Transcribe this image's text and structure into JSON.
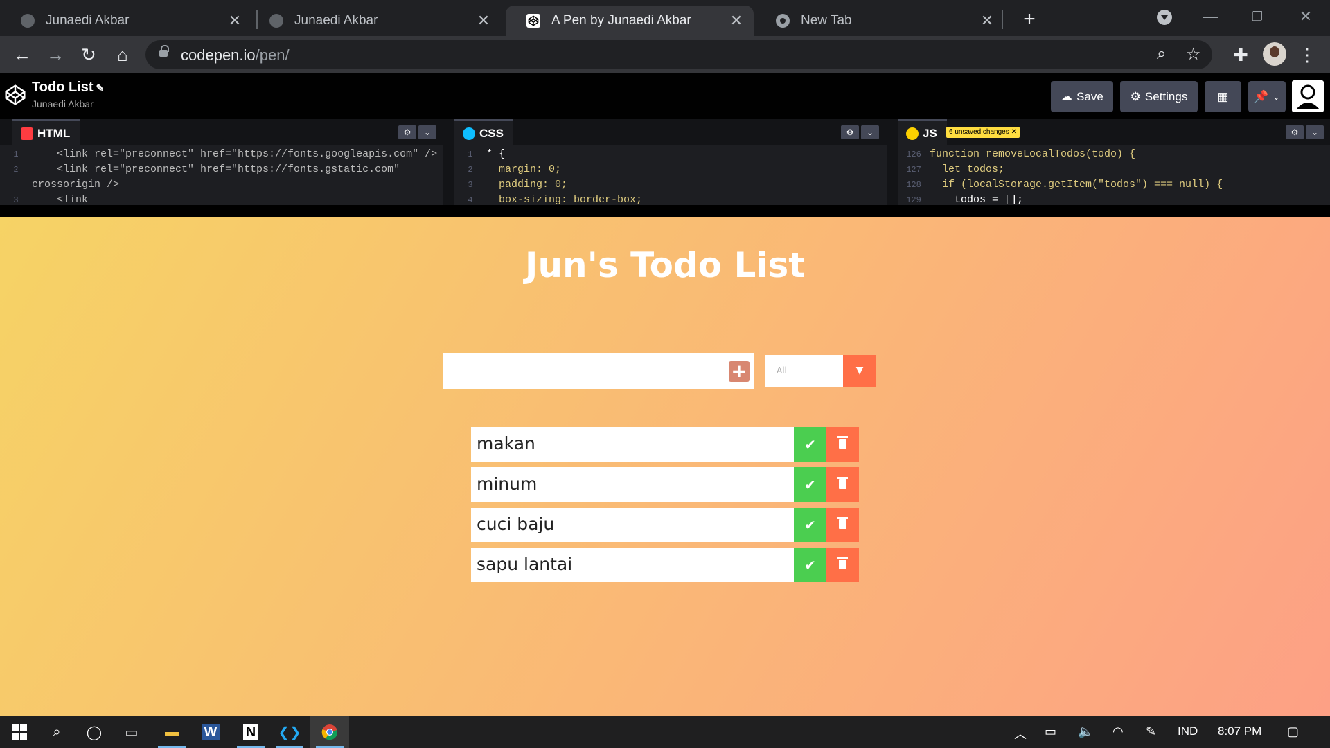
{
  "browser": {
    "tabs": [
      {
        "title": "Junaedi Akbar",
        "active": false
      },
      {
        "title": "Junaedi Akbar",
        "active": false
      },
      {
        "title": "A Pen by Junaedi Akbar",
        "active": true
      },
      {
        "title": "New Tab",
        "active": false
      }
    ],
    "url_host": "codepen.io",
    "url_path": "/pen/"
  },
  "codepen": {
    "pen_title": "Todo List",
    "author": "Junaedi Akbar",
    "save_label": "Save",
    "settings_label": "Settings",
    "editors": {
      "html": {
        "label": "HTML",
        "lines": [
          {
            "n": "1",
            "text": "    <link rel=\"preconnect\" href=\"https://fonts.googleapis.com\" />"
          },
          {
            "n": "2",
            "text": "    <link rel=\"preconnect\" href=\"https://fonts.gstatic.com\""
          },
          {
            "n": "",
            "text": "crossorigin />"
          },
          {
            "n": "3",
            "text": "    <link"
          }
        ]
      },
      "css": {
        "label": "CSS",
        "lines": [
          {
            "n": "1",
            "text": "* {"
          },
          {
            "n": "2",
            "text": "  margin: 0;"
          },
          {
            "n": "3",
            "text": "  padding: 0;"
          },
          {
            "n": "4",
            "text": "  box-sizing: border-box;"
          }
        ]
      },
      "js": {
        "label": "JS",
        "unsaved_badge": "6 unsaved changes ✕",
        "lines": [
          {
            "n": "126",
            "text": "function removeLocalTodos(todo) {"
          },
          {
            "n": "127",
            "text": "  let todos;"
          },
          {
            "n": "128",
            "text": "  if (localStorage.getItem(\"todos\") === null) {"
          },
          {
            "n": "129",
            "text": "    todos = [];"
          }
        ]
      }
    }
  },
  "app": {
    "title": "Jun's Todo List",
    "input_value": "",
    "filter_selected": "All",
    "todos": [
      {
        "text": "makan"
      },
      {
        "text": "minum"
      },
      {
        "text": "cuci baju"
      },
      {
        "text": "sapu lantai"
      }
    ],
    "colors": {
      "gradient_start": "#f6d365",
      "gradient_end": "#fda085",
      "check": "#4bce50",
      "trash": "#ff6f47"
    }
  },
  "taskbar": {
    "language": "IND",
    "time": "8:07 PM"
  }
}
